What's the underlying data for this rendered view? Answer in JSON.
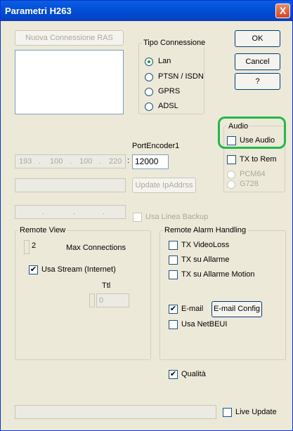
{
  "window": {
    "title": "Parametri H263",
    "close_glyph": "X"
  },
  "buttons": {
    "nuova_connessione": "Nuova Connessione RAS",
    "ok": "OK",
    "cancel": "Cancel",
    "help": "?",
    "update_ip": "Update IpAddrss",
    "email_config": "E-mail Config"
  },
  "tipo_connessione": {
    "label": "Tipo Connessione",
    "options": [
      "Lan",
      "PTSN / ISDN",
      "GPRS",
      "ADSL"
    ],
    "selected": "Lan"
  },
  "audio": {
    "label": "Audio",
    "use_audio": "Use Audio",
    "tx_to_rem": "TX to Rem",
    "codec_options": [
      "PCM64",
      "G728"
    ]
  },
  "network": {
    "port_encoder_label": "PortEncoder1",
    "ip_octets": [
      "193",
      "100",
      "100",
      "220"
    ],
    "ip_separator": ".",
    "colon": ":",
    "port_value": "12000",
    "backup_label": "Usa Linea Backup"
  },
  "remote_view": {
    "label": "Remote View",
    "max_connections_value": "2",
    "max_connections_label": "Max Connections",
    "usa_stream_label": "Usa Stream (Internet)",
    "ttl_label": "Ttl",
    "ttl_value": "0"
  },
  "remote_alarm": {
    "label": "Remote Alarm Handling",
    "tx_videoloss": "TX VideoLoss",
    "tx_allarme": "TX su Allarme",
    "tx_allarme_motion": "TX su Allarme Motion",
    "email": "E-mail",
    "usa_netbeui": "Usa NetBEUI"
  },
  "qualita_label": "Qualità",
  "live_update_label": "Live Update",
  "checkmark": "✔",
  "colors": {
    "title_bar": "#0350d8",
    "highlight": "#22b94a",
    "dialog_bg": "#ece9d8"
  }
}
